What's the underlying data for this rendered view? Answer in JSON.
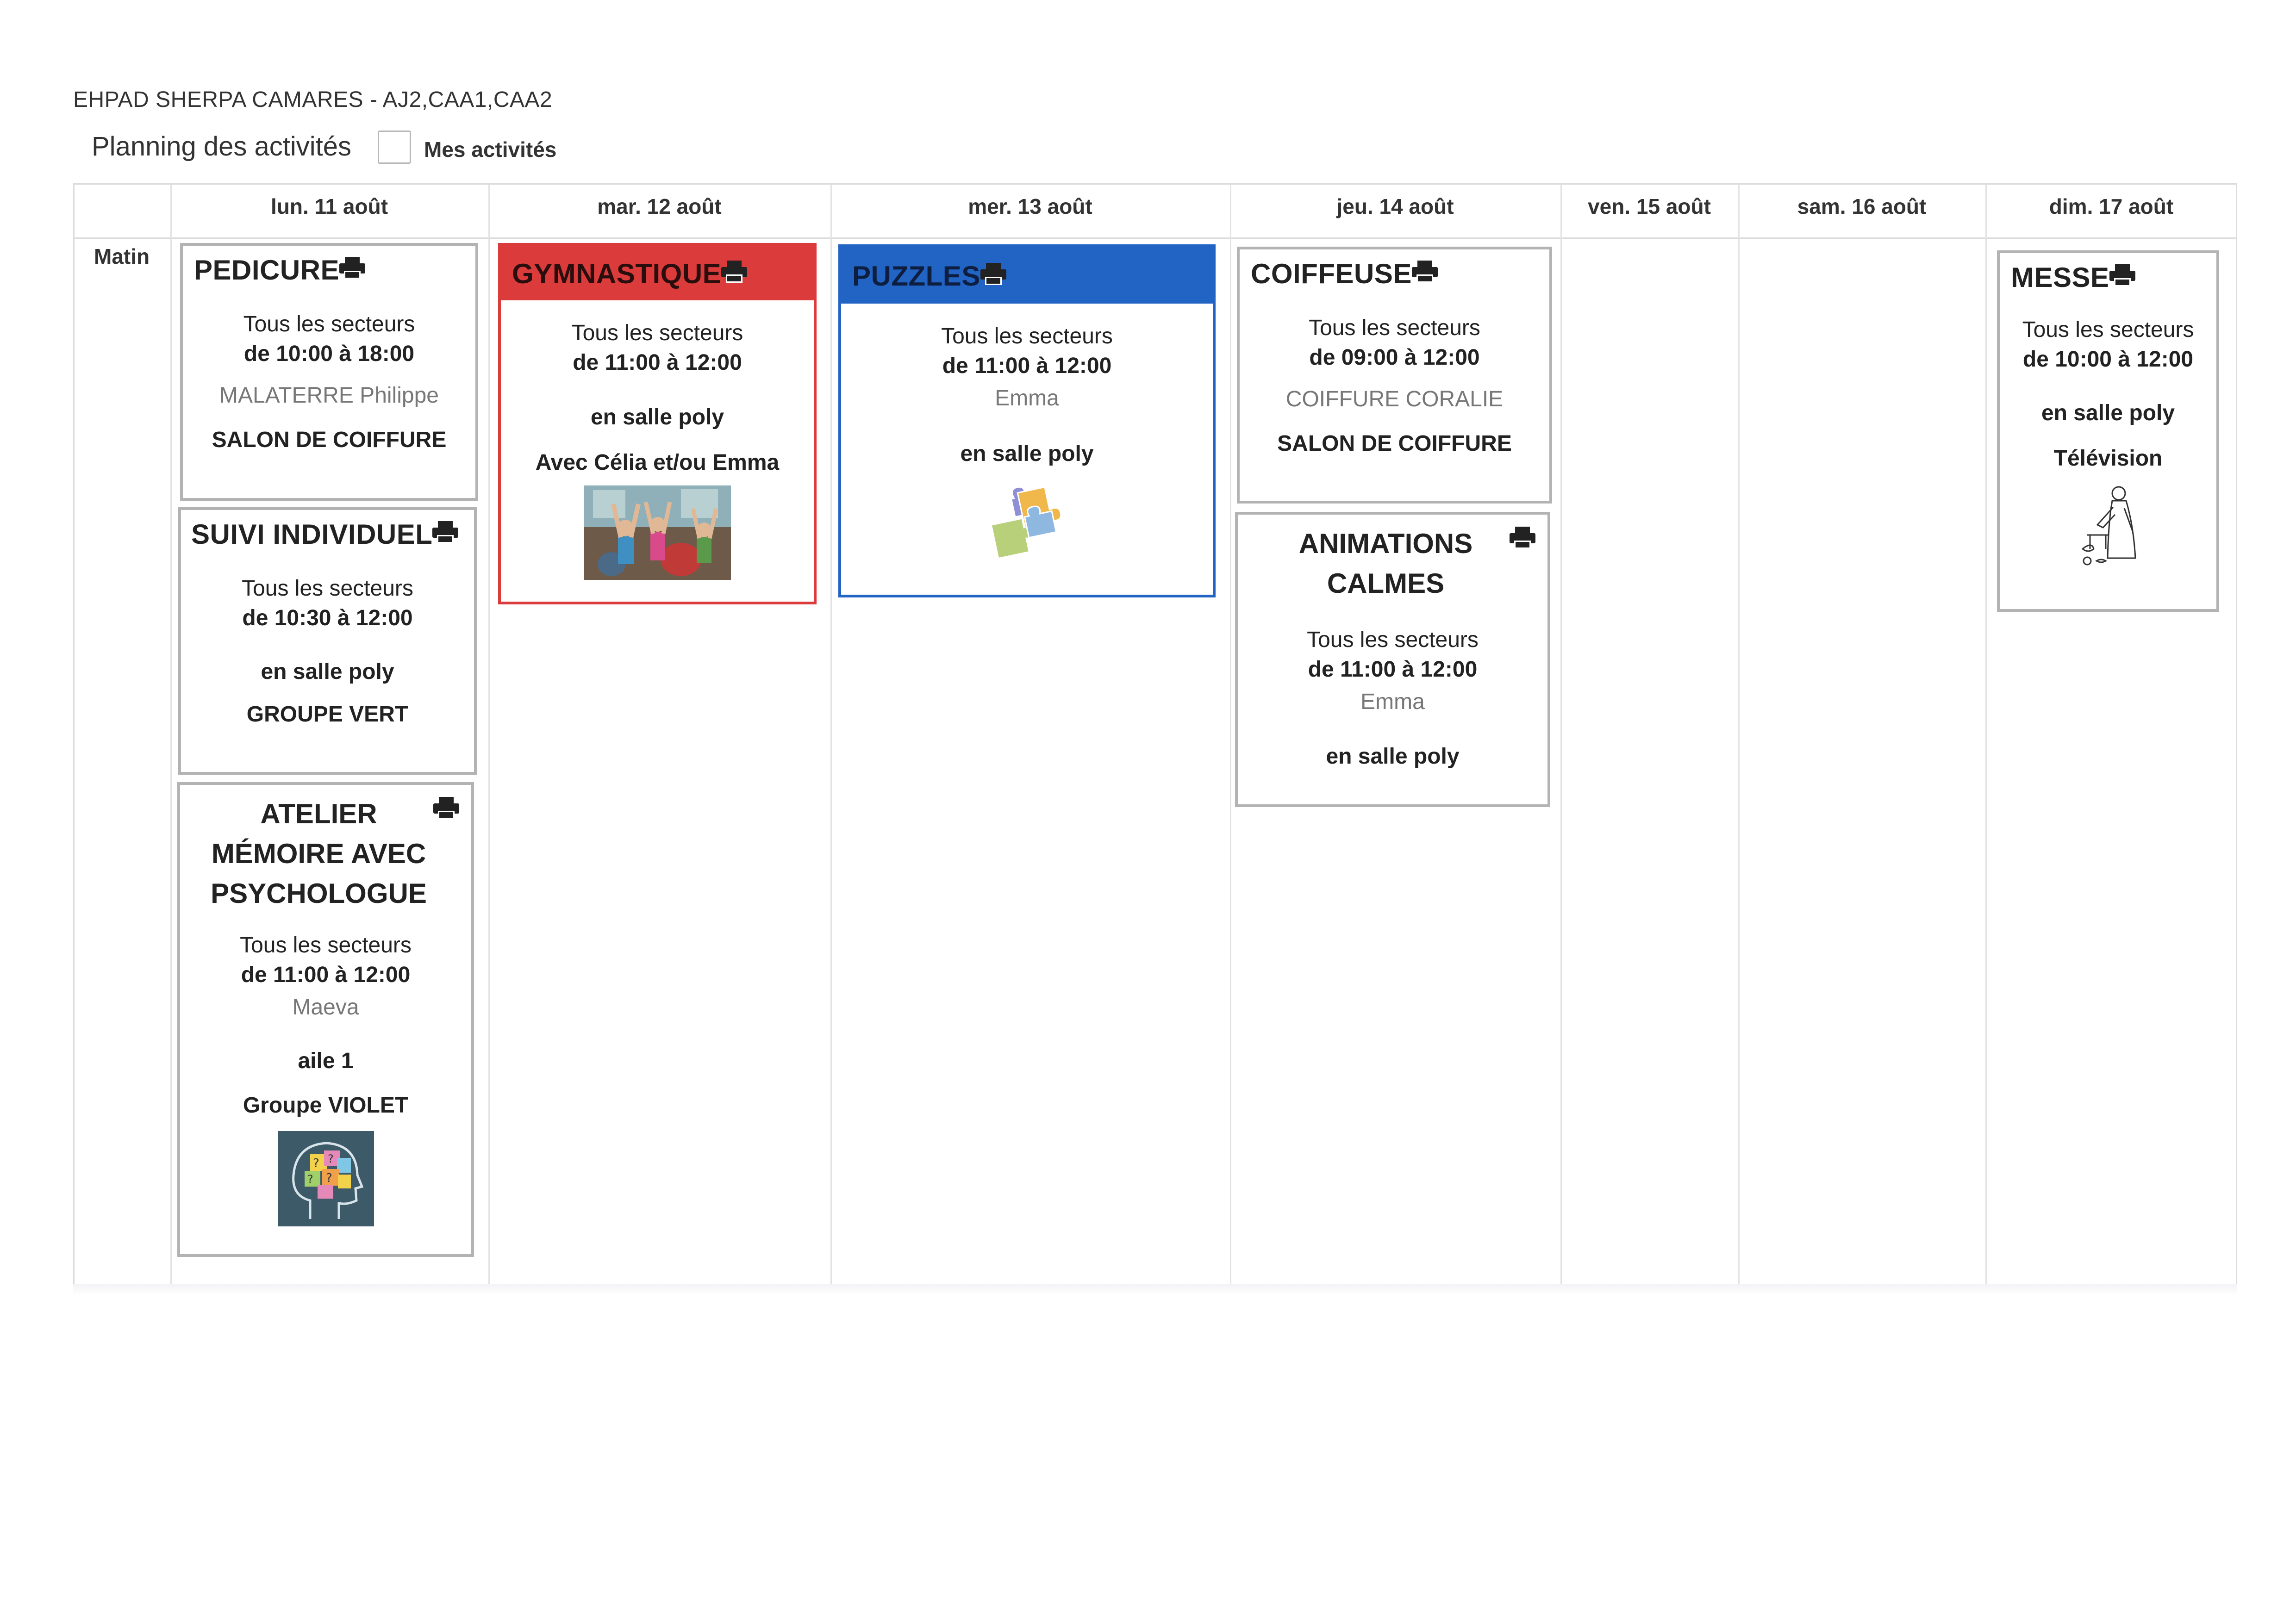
{
  "header": {
    "org": "EHPAD SHERPA CAMARES - AJ2,CAA1,CAA2",
    "title": "Planning des activités",
    "my_activities_label": "Mes activités",
    "my_activities_checked": false
  },
  "grid": {
    "period": "Matin",
    "days": [
      "lun. 11 août",
      "mar. 12 août",
      "mer. 13 août",
      "jeu. 14 août",
      "ven. 15 août",
      "sam. 16 août",
      "dim. 17 août"
    ]
  },
  "activities": {
    "pedicure": {
      "title": "PEDICURE",
      "sector": "Tous les secteurs",
      "time": "de 10:00 à 18:00",
      "staff": "MALATERRE Philippe",
      "place": "SALON DE COIFFURE"
    },
    "suivi": {
      "title": "SUIVI INDIVIDUEL",
      "sector": "Tous les secteurs",
      "time": "de 10:30 à 12:00",
      "place": "en salle poly",
      "group": "GROUPE VERT"
    },
    "atelier": {
      "title_lines": [
        "ATELIER",
        "MÉMOIRE AVEC",
        "PSYCHOLOGUE"
      ],
      "sector": "Tous les secteurs",
      "time": "de 11:00 à 12:00",
      "staff": "Maeva",
      "place": "aile 1",
      "group": "Groupe VIOLET"
    },
    "gym": {
      "title": "GYMNASTIQUE",
      "sector": "Tous les secteurs",
      "time": "de 11:00 à 12:00",
      "place": "en salle poly",
      "note": "Avec Célia et/ou Emma",
      "color": "#dc3b3b"
    },
    "puzzles": {
      "title": "PUZZLES",
      "sector": "Tous les secteurs",
      "time": "de 11:00 à 12:00",
      "staff": "Emma",
      "place": "en salle poly",
      "color": "#2264c4"
    },
    "coiffeuse": {
      "title": "COIFFEUSE",
      "sector": "Tous les secteurs",
      "time": "de 09:00 à 12:00",
      "staff": "COIFFURE CORALIE",
      "place": "SALON DE COIFFURE"
    },
    "animations": {
      "title_lines": [
        "ANIMATIONS",
        "CALMES"
      ],
      "sector": "Tous les secteurs",
      "time": "de 11:00 à 12:00",
      "staff": "Emma",
      "place": "en salle poly"
    },
    "messe": {
      "title": "MESSE",
      "sector": "Tous les secteurs",
      "time": "de 10:00 à 12:00",
      "place": "en salle poly",
      "note": "Télévision"
    }
  }
}
